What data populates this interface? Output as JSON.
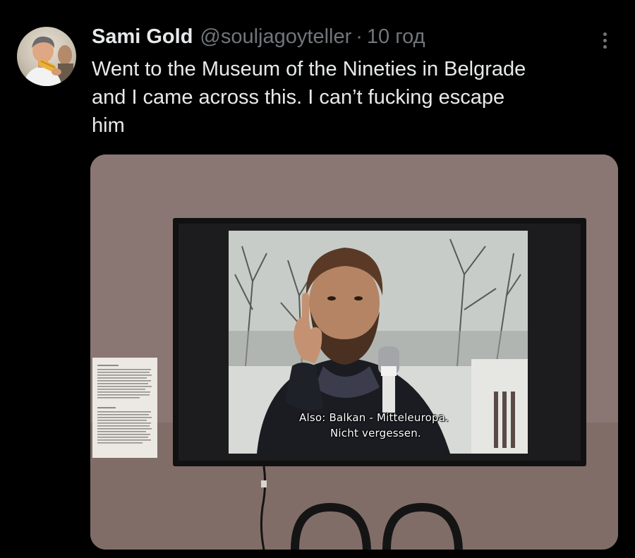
{
  "post": {
    "author": {
      "display_name": "Sami Gold",
      "handle": "@souljagoyteller",
      "separator": "·",
      "time_ago": "10 год"
    },
    "text": "Went to the Museum of the Nineties in Belgrade\nand I came across this. I can’t fucking escape\nhim",
    "media": {
      "subtitle_line1": "Also: Balkan - Mitteleuropa.",
      "subtitle_line2": "Nicht vergessen."
    }
  },
  "icons": {
    "more": "more-options-icon",
    "avatar": "avatar"
  },
  "colors": {
    "background": "#000000",
    "text_primary": "#e7e9ea",
    "text_secondary": "#71767b"
  }
}
